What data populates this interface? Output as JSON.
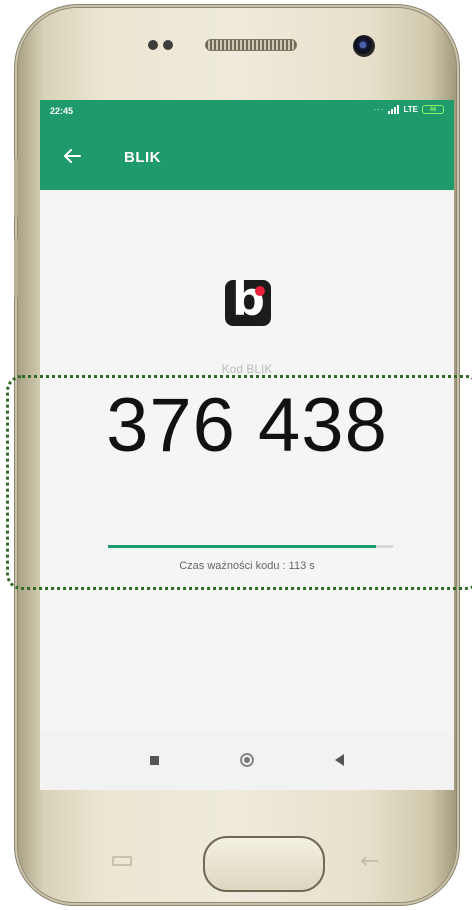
{
  "status_bar": {
    "time": "22:45",
    "network": "LTE",
    "battery": "46"
  },
  "app_bar": {
    "title": "BLIK"
  },
  "blik": {
    "label": "Kod BLIK",
    "code": "376 438",
    "validity_text": "Czas ważności kodu : 113 s",
    "progress_fraction": 0.94
  },
  "colors": {
    "accent": "#1e9a6b",
    "logo_red": "#e8203a",
    "highlight_border": "#2f6b24"
  }
}
